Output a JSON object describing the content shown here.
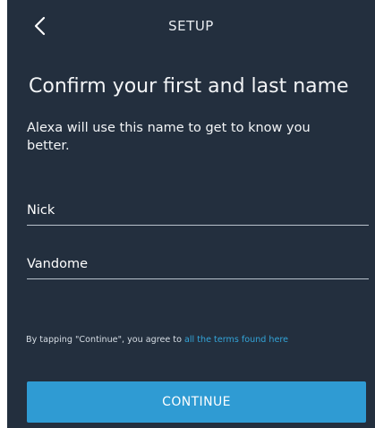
{
  "header": {
    "title": "SETUP",
    "back_icon": "chevron-left-icon"
  },
  "main": {
    "headline": "Confirm your first and last name",
    "subtitle": "Alexa will use this name to get to know you better.",
    "first_name_value": "Nick",
    "last_name_value": "Vandome"
  },
  "footer": {
    "terms_prefix": "By tapping \"Continue\", you agree to ",
    "terms_link": "all the terms found here",
    "continue_label": "CONTINUE"
  },
  "colors": {
    "background": "#232f3e",
    "accent": "#2f9bd3",
    "link": "#33a4d8",
    "text": "#ffffff"
  }
}
